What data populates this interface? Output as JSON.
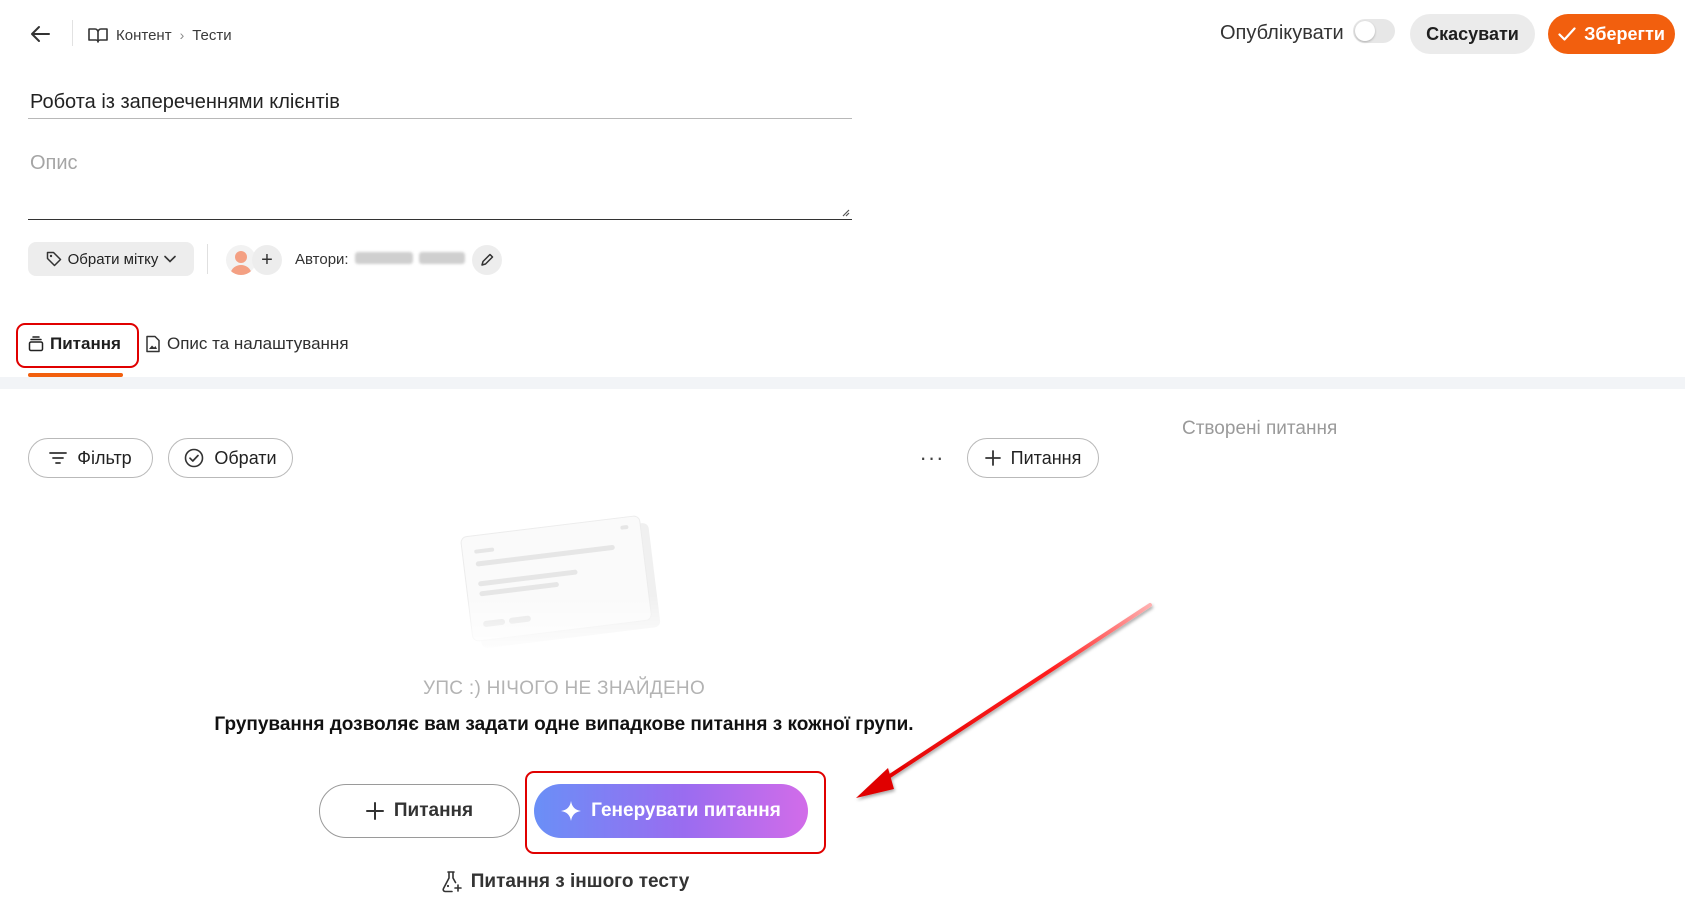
{
  "header": {
    "back_icon": "arrow-left-icon",
    "breadcrumb": [
      {
        "label": "Контент",
        "icon": "book-open-icon"
      },
      {
        "label": "Тести"
      }
    ],
    "publish_label": "Опублікувати",
    "publish_enabled": false,
    "cancel_label": "Скасувати",
    "save_label": "Зберегти",
    "accent_color": "#f25f0e"
  },
  "form": {
    "title_value": "Робота із запереченнями клієнтів",
    "description_placeholder": "Опис"
  },
  "meta": {
    "tag_button_label": "Обрати мітку",
    "authors_label": "Автори:",
    "add_author_label": "+"
  },
  "tabs": [
    {
      "label": "Питання",
      "active": true,
      "icon": "stack-icon"
    },
    {
      "label": "Опис та налаштування",
      "active": false,
      "icon": "document-image-icon"
    }
  ],
  "toolbar": {
    "filter_label": "Фільтр",
    "select_label": "Обрати",
    "more_label": "···",
    "add_question_label": "Питання",
    "created_questions_label": "Створені питання"
  },
  "empty_state": {
    "title": "УПС :) НІЧОГО НЕ ЗНАЙДЕНО",
    "hint": "Групування дозволяє вам задати одне випадкове питання з кожної групи.",
    "add_question_label": "Питання",
    "generate_label": "Генерувати питання",
    "from_other_test_label": "Питання з іншого тесту"
  }
}
